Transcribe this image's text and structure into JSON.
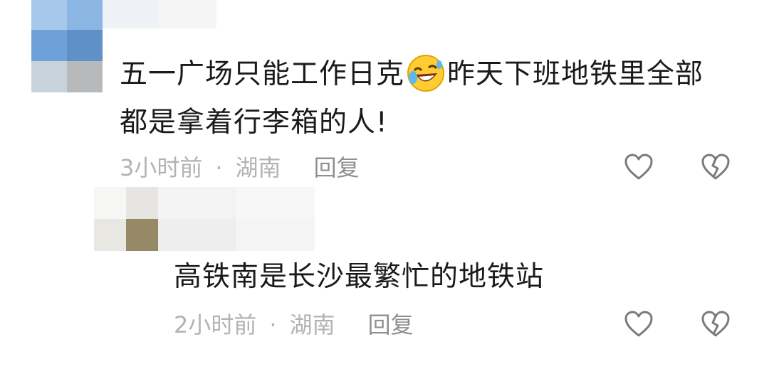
{
  "comments": [
    {
      "line1_before": "五一广场只能工作日克",
      "emoji": "rolling-on-floor-laughing-icon",
      "line1_after": "昨天下班地铁里全部",
      "line2": "都是拿着行李箱的人!",
      "time": "3小时前",
      "separator": "·",
      "location": "湖南",
      "reply_label": "回复"
    },
    {
      "text": "高铁南是长沙最繁忙的地铁站",
      "time": "2小时前",
      "separator": "·",
      "location": "湖南",
      "reply_label": "回复"
    }
  ],
  "colors": {
    "text": "#1a1a1a",
    "meta": "#b3b3b3",
    "reply": "#8f8f8f",
    "icon": "#7a7a7a"
  }
}
